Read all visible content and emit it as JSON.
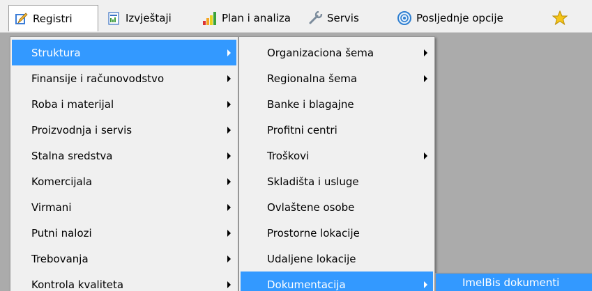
{
  "menubar": {
    "items": [
      {
        "label": "Registri",
        "icon": "pencil-icon"
      },
      {
        "label": "Izvještaji",
        "icon": "report-icon"
      },
      {
        "label": "Plan i analiza",
        "icon": "bar-chart-icon"
      },
      {
        "label": "Servis",
        "icon": "wrench-icon"
      },
      {
        "label": "Posljednje opcije",
        "icon": "history-icon"
      },
      {
        "label": "",
        "icon": "star-icon"
      }
    ]
  },
  "menu_level1": {
    "items": [
      {
        "label": "Struktura",
        "submenu": true
      },
      {
        "label": "Finansije i računovodstvo",
        "submenu": true
      },
      {
        "label": "Roba i materijal",
        "submenu": true
      },
      {
        "label": "Proizvodnja i servis",
        "submenu": true
      },
      {
        "label": "Stalna sredstva",
        "submenu": true
      },
      {
        "label": "Komercijala",
        "submenu": true
      },
      {
        "label": "Virmani",
        "submenu": true
      },
      {
        "label": "Putni nalozi",
        "submenu": true
      },
      {
        "label": "Trebovanja",
        "submenu": true
      },
      {
        "label": "Kontrola kvaliteta",
        "submenu": true
      }
    ]
  },
  "menu_level2": {
    "items": [
      {
        "label": "Organizaciona šema",
        "submenu": true
      },
      {
        "label": "Regionalna šema",
        "submenu": true
      },
      {
        "label": "Banke i blagajne",
        "submenu": false
      },
      {
        "label": "Profitni centri",
        "submenu": false
      },
      {
        "label": "Troškovi",
        "submenu": true
      },
      {
        "label": "Skladišta i usluge",
        "submenu": false
      },
      {
        "label": "Ovlaštene osobe",
        "submenu": false
      },
      {
        "label": "Prostorne lokacije",
        "submenu": false
      },
      {
        "label": "Udaljene lokacije",
        "submenu": false
      },
      {
        "label": "Dokumentacija",
        "submenu": true
      }
    ]
  },
  "menu_level3": {
    "items": [
      {
        "label": "ImelBis dokumenti",
        "submenu": false
      }
    ]
  },
  "colors": {
    "highlight": "#3399ff",
    "menu_bg": "#f0f0f0",
    "workspace_bg": "#ababab"
  }
}
